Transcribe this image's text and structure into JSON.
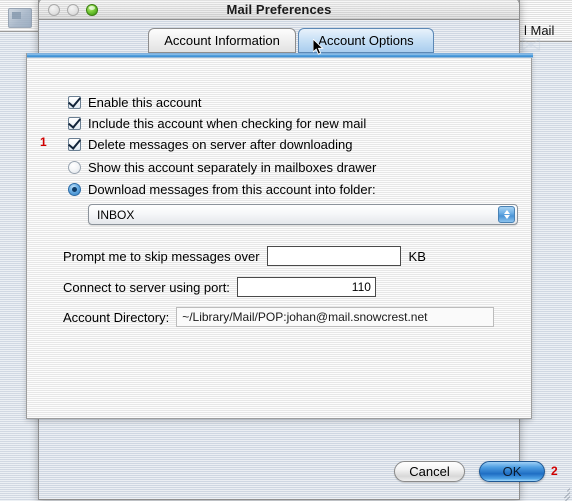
{
  "window": {
    "title": "Mail Preferences",
    "controls": {
      "close": "close-button",
      "minimize": "minimize-button",
      "zoom": "zoom-button"
    }
  },
  "background_windows": {
    "right_title": "l Mail"
  },
  "watermarks": {
    "at_symbol": "@",
    "right_symbol": "✉",
    "right_lines": "≡≡≡"
  },
  "tabs": [
    {
      "label": "Account Information",
      "selected": false
    },
    {
      "label": "Account Options",
      "selected": true
    }
  ],
  "options": {
    "checkboxes": [
      {
        "label": "Enable this account",
        "checked": true
      },
      {
        "label": "Include this account when checking for new mail",
        "checked": true
      },
      {
        "label": "Delete messages on server after downloading",
        "checked": true
      }
    ],
    "radios": [
      {
        "label": "Show this account separately in mailboxes drawer",
        "selected": false
      },
      {
        "label": "Download messages from this account into folder:",
        "selected": true
      }
    ],
    "folder_popup": {
      "value": "INBOX",
      "options": [
        "INBOX"
      ]
    }
  },
  "fields": {
    "skip_messages": {
      "label": "Prompt me to skip messages over",
      "value": "",
      "placeholder": "",
      "unit": "KB"
    },
    "server_port": {
      "label": "Connect to server using port:",
      "value": "110",
      "placeholder": ""
    },
    "account_directory": {
      "label": "Account Directory:",
      "value": "~/Library/Mail/POP:johan@mail.snowcrest.net"
    }
  },
  "buttons": {
    "cancel": "Cancel",
    "ok": "OK"
  },
  "annotations": [
    {
      "id": "1",
      "text": "1"
    },
    {
      "id": "2",
      "text": "2"
    }
  ],
  "colors": {
    "accent_blue": "#3f8fd2",
    "default_button_blue": "#1f6ec4",
    "annotation_red": "#d00000",
    "zoom_green": "#3f9c14"
  }
}
